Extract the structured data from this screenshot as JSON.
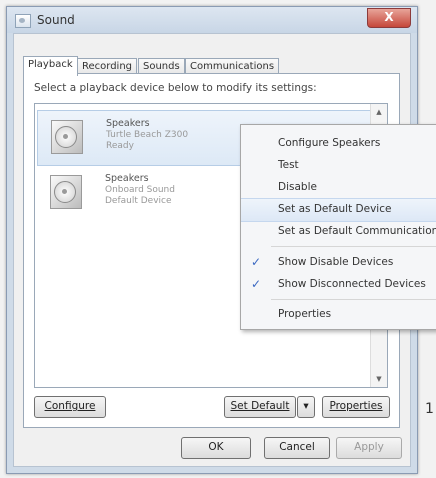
{
  "window": {
    "title": "Sound",
    "close_label": "X"
  },
  "tabs": [
    {
      "label": "Playback",
      "active": true
    },
    {
      "label": "Recording",
      "active": false
    },
    {
      "label": "Sounds",
      "active": false
    },
    {
      "label": "Communications",
      "active": false
    }
  ],
  "instruction": "Select a playback device below to modify its settings:",
  "devices": [
    {
      "name": "Speakers",
      "line1": "Turtle Beach Z300",
      "line2": "Ready",
      "selected": true
    },
    {
      "name": "Speakers",
      "line1": "Onboard Sound",
      "line2": "Default Device",
      "selected": false
    }
  ],
  "context_menu": {
    "items": [
      {
        "label": "Configure Speakers",
        "checked": false
      },
      {
        "label": "Test",
        "checked": false
      },
      {
        "label": "Disable",
        "checked": false
      },
      {
        "label": "Set as Default Device",
        "checked": false,
        "highlighted": true
      },
      {
        "label": "Set as Default Communication Device",
        "checked": false
      },
      {
        "label": "Show Disable Devices",
        "checked": true
      },
      {
        "label": "Show Disconnected Devices",
        "checked": true
      },
      {
        "label": "Properties",
        "checked": false
      }
    ],
    "check_glyph": "✓"
  },
  "buttons": {
    "configure": "Configure",
    "set_default": "Set Default",
    "set_default_arrow": "▾",
    "properties": "Properties",
    "ok": "OK",
    "cancel": "Cancel",
    "apply": "Apply"
  },
  "scroll": {
    "up": "▲",
    "down": "▼"
  },
  "stray_mark": "1"
}
